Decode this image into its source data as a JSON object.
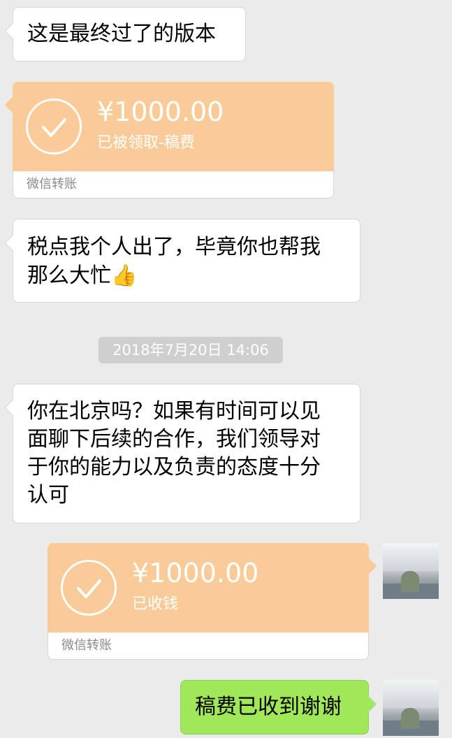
{
  "messages": {
    "m1": {
      "text": "这是最终过了的版本"
    },
    "m2": {
      "amount": "¥1000.00",
      "status": "已被领取-稿费",
      "footer": "微信转账"
    },
    "m3": {
      "line1": "税点我个人出了，毕竟你也帮我",
      "line2": "那么大忙",
      "emoji": "👍"
    },
    "timestamp": "2018年7月20日 14:06",
    "m4": {
      "line1": "你在北京吗？如果有时间可以见",
      "line2": "面聊下后续的合作，我们领导对",
      "line3": "于你的能力以及负责的态度十分",
      "line4": "认可"
    },
    "m5": {
      "amount": "¥1000.00",
      "status": "已收钱",
      "footer": "微信转账"
    },
    "m6": {
      "text": "稿费已收到谢谢"
    }
  },
  "colors": {
    "background": "#ebebeb",
    "transfer": "#f9cb98",
    "sent_bubble": "#a0e75a"
  },
  "icons": {
    "check": "check-circle-icon",
    "avatar": "user-avatar"
  }
}
